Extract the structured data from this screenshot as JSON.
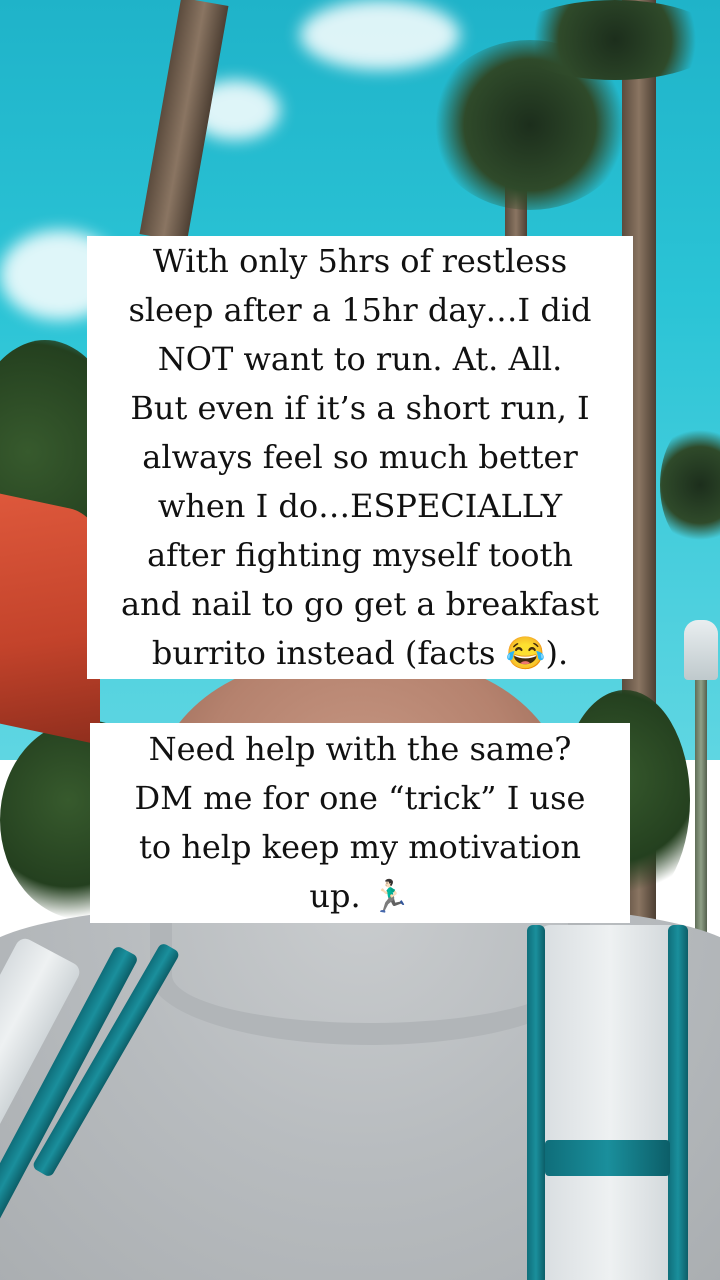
{
  "story": {
    "caption_1": {
      "lines": [
        "With only 5hrs of restless",
        "sleep after a 15hr day…I did",
        "NOT want to run. At. All.",
        "But even if it’s a short run, I",
        "always feel so much better",
        "when I do…ESPECIALLY",
        "after fighting myself tooth",
        "and nail to go get a breakfast",
        "burrito instead (facts 😂)."
      ]
    },
    "caption_2": {
      "lines": [
        "Need help with the same?",
        "DM me for one “trick” I use",
        "to help keep my motivation",
        "up. 🏃🏻‍♂️"
      ]
    }
  },
  "colors": {
    "caption_background": "#ffffff",
    "caption_text": "#111111",
    "sky": "#2bc4d6",
    "strap_teal": "#1a8f9c"
  }
}
